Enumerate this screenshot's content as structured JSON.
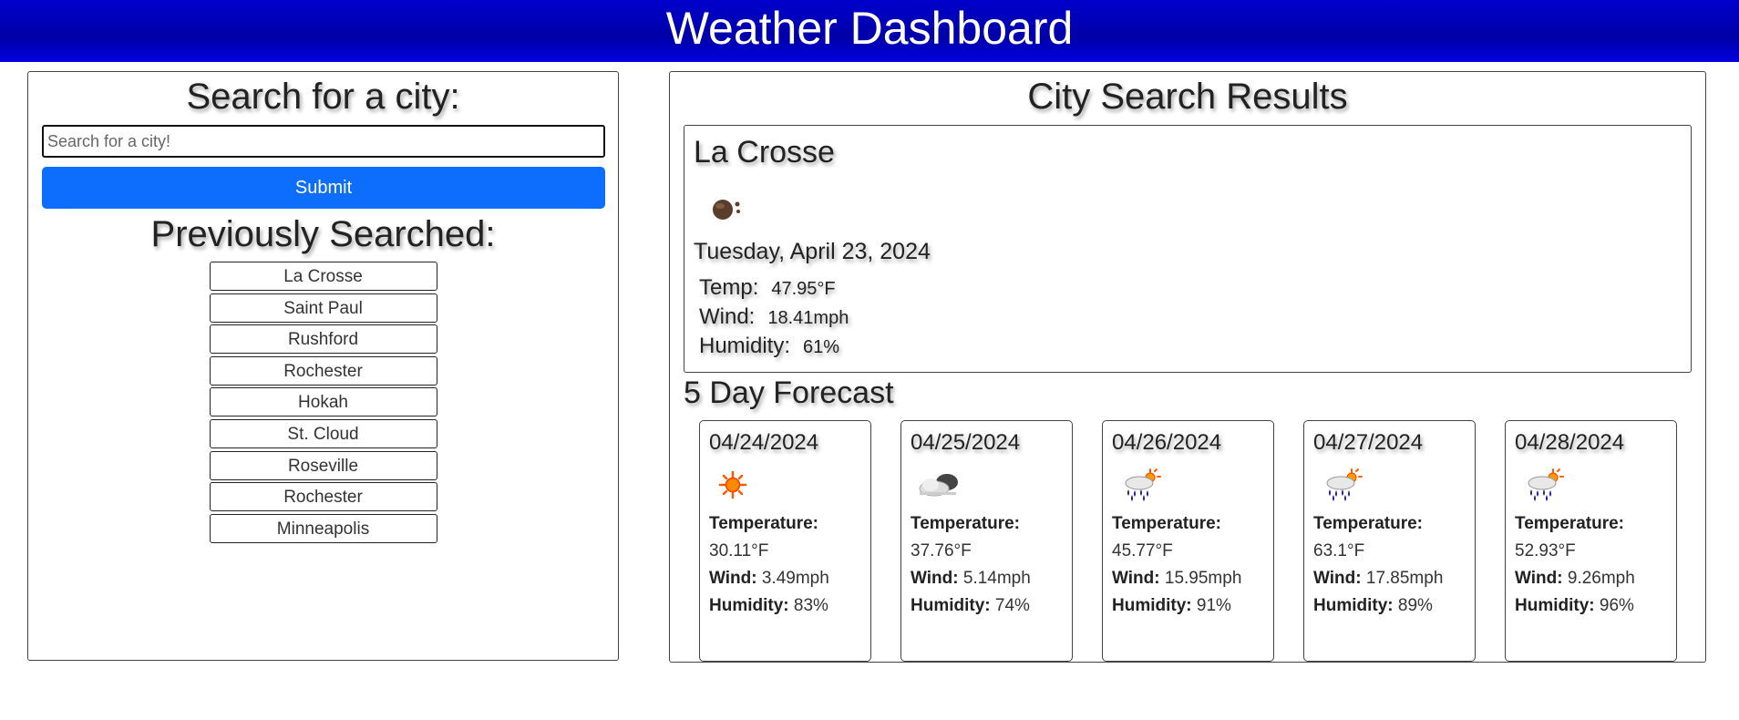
{
  "header": {
    "title": "Weather Dashboard"
  },
  "search": {
    "title": "Search for a city:",
    "placeholder": "Search for a city!",
    "submit_label": "Submit"
  },
  "history": {
    "title": "Previously Searched:",
    "items": [
      "La Crosse",
      "Saint Paul",
      "Rushford",
      "Rochester",
      "Hokah",
      "St. Cloud",
      "Roseville",
      "Rochester",
      "Minneapolis"
    ]
  },
  "results": {
    "title": "City Search Results",
    "current": {
      "city": "La Crosse",
      "icon": "rain-drops-icon",
      "date": "Tuesday, April 23, 2024",
      "temp_label": "Temp:",
      "temp": "47.95°F",
      "wind_label": "Wind:",
      "wind": "18.41mph",
      "humidity_label": "Humidity:",
      "humidity": "61%"
    },
    "forecast_title": "5 Day Forecast",
    "labels": {
      "temperature": "Temperature:",
      "wind": "Wind:",
      "humidity": "Humidity:"
    },
    "forecast": [
      {
        "date": "04/24/2024",
        "icon": "sun-icon",
        "temp": "30.11°F",
        "wind": "3.49mph",
        "humidity": "83%"
      },
      {
        "date": "04/25/2024",
        "icon": "cloud-icon",
        "temp": "37.76°F",
        "wind": "5.14mph",
        "humidity": "74%"
      },
      {
        "date": "04/26/2024",
        "icon": "sun-rain-icon",
        "temp": "45.77°F",
        "wind": "15.95mph",
        "humidity": "91%"
      },
      {
        "date": "04/27/2024",
        "icon": "sun-rain-icon",
        "temp": "63.1°F",
        "wind": "17.85mph",
        "humidity": "89%"
      },
      {
        "date": "04/28/2024",
        "icon": "sun-rain-icon",
        "temp": "52.93°F",
        "wind": "9.26mph",
        "humidity": "96%"
      }
    ]
  },
  "colors": {
    "header_bg": "#0000cc",
    "submit_bg": "#0d6efd"
  }
}
